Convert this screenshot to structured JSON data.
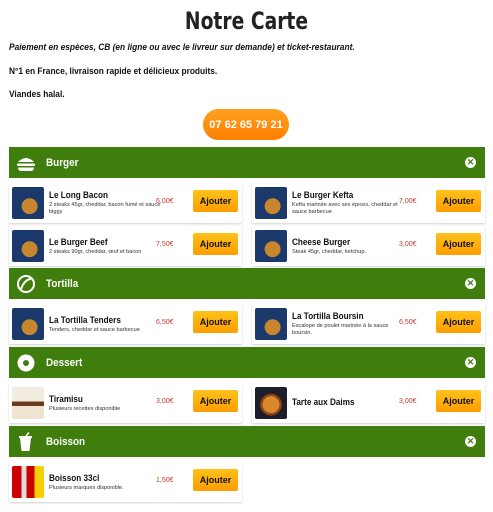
{
  "header": {
    "title": "Notre Carte",
    "payment": "Paiement en espèces, CB (en ligne ou avec le livreur sur demande) et ticket-restaurant.",
    "tagline": "N°1 en France, livraison rapide et délicieux produits.",
    "halal": "Viandes halal.",
    "phone": "07 62 65 79 21"
  },
  "colors": {
    "category_bar": "#3f7d0c",
    "button": "#ffa500",
    "price": "#c0392b",
    "phone_button": "#ff8c00"
  },
  "add_label": "Ajouter",
  "close_glyph": "✕",
  "categories": [
    {
      "name": "Burger",
      "icon": "burger-icon",
      "items": [
        {
          "name": "Le Long Bacon",
          "desc": "2 steaks 45gr, cheddar, bacon fumé et sauce biggy",
          "price": "6,00€"
        },
        {
          "name": "Le Burger Kefta",
          "desc": "Kefta marinée avec ses épices, cheddar et sauce barbecue",
          "price": "7,00€"
        },
        {
          "name": "Le Burger Beef",
          "desc": "2 steaks 90gr, cheddar, œuf et bacon",
          "price": "7,50€"
        },
        {
          "name": "Cheese Burger",
          "desc": "Steak 45gr, cheddar, ketchup.",
          "price": "3,00€"
        }
      ]
    },
    {
      "name": "Tortilla",
      "icon": "tortilla-icon",
      "items": [
        {
          "name": "La Tortilla Tenders",
          "desc": "Tenders, cheddar et sauce barbecue",
          "price": "6,50€"
        },
        {
          "name": "La Tortilla Boursin",
          "desc": "Escalope de poulet marinée à la sauce boursin.",
          "price": "6,50€"
        }
      ]
    },
    {
      "name": "Dessert",
      "icon": "donut-icon",
      "items": [
        {
          "name": "Tiramisu",
          "desc": "Plusieurs recettes disponible",
          "price": "3,00€"
        },
        {
          "name": "Tarte aux Daims",
          "desc": "",
          "price": "3,00€"
        }
      ]
    },
    {
      "name": "Boisson",
      "icon": "drink-icon",
      "items": [
        {
          "name": "Boisson 33cl",
          "desc": "Plusieurs marques disponible.",
          "price": "1,50€"
        }
      ]
    }
  ]
}
